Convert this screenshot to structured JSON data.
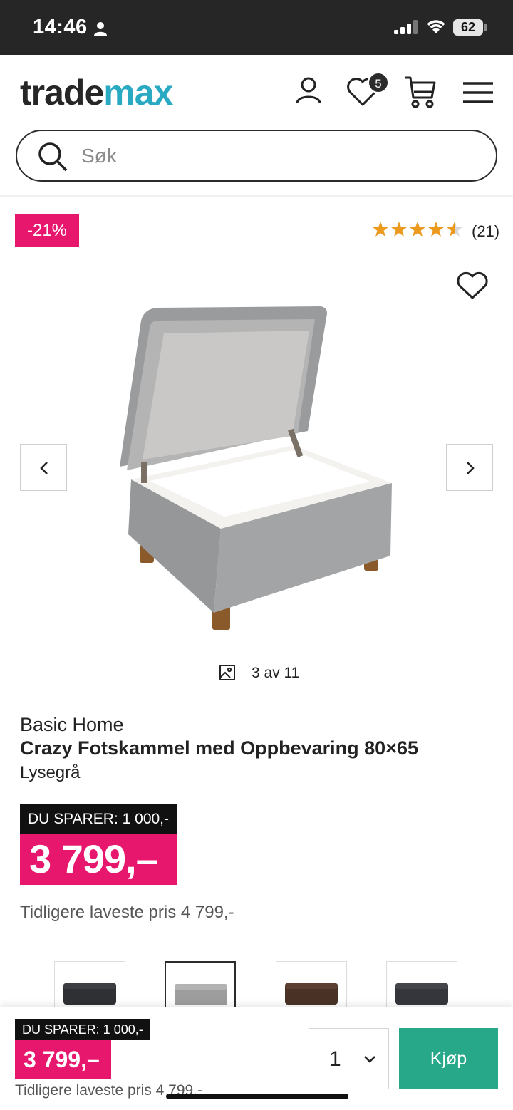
{
  "status_bar": {
    "time": "14:46",
    "battery": "62"
  },
  "header": {
    "logo_part1": "trade",
    "logo_part2": "max",
    "wishlist_count": "5",
    "search_placeholder": "Søk"
  },
  "gallery": {
    "discount_badge": "-21%",
    "rating": 4.5,
    "rating_max": 5,
    "review_count": "(21)",
    "image_counter": "3 av 11"
  },
  "product": {
    "brand": "Basic Home",
    "title": "Crazy Fotskammel med Oppbevaring 80×65",
    "variant": "Lysegrå",
    "savings": "DU SPARER: 1 000,-",
    "price": "3 799,–",
    "previous_lowest_price": "Tidligere laveste pris 4 799,-"
  },
  "variants": [
    {
      "color_name": "dark-grey",
      "color": "#2e3034",
      "selected": false
    },
    {
      "color_name": "light-grey",
      "color": "#9d9d9d",
      "selected": true
    },
    {
      "color_name": "brown",
      "color": "#4a3226",
      "selected": false
    },
    {
      "color_name": "anthracite",
      "color": "#34363b",
      "selected": false
    }
  ],
  "sticky_bar": {
    "savings": "DU SPARER: 1 000,-",
    "price": "3 799,–",
    "previous_lowest_price": "Tidligere laveste pris 4 799,-",
    "quantity": "1",
    "buy_label": "Kjøp"
  },
  "colors": {
    "accent_pink": "#e8176e",
    "buy_green": "#26a889",
    "logo_teal": "#2aa9c3"
  }
}
